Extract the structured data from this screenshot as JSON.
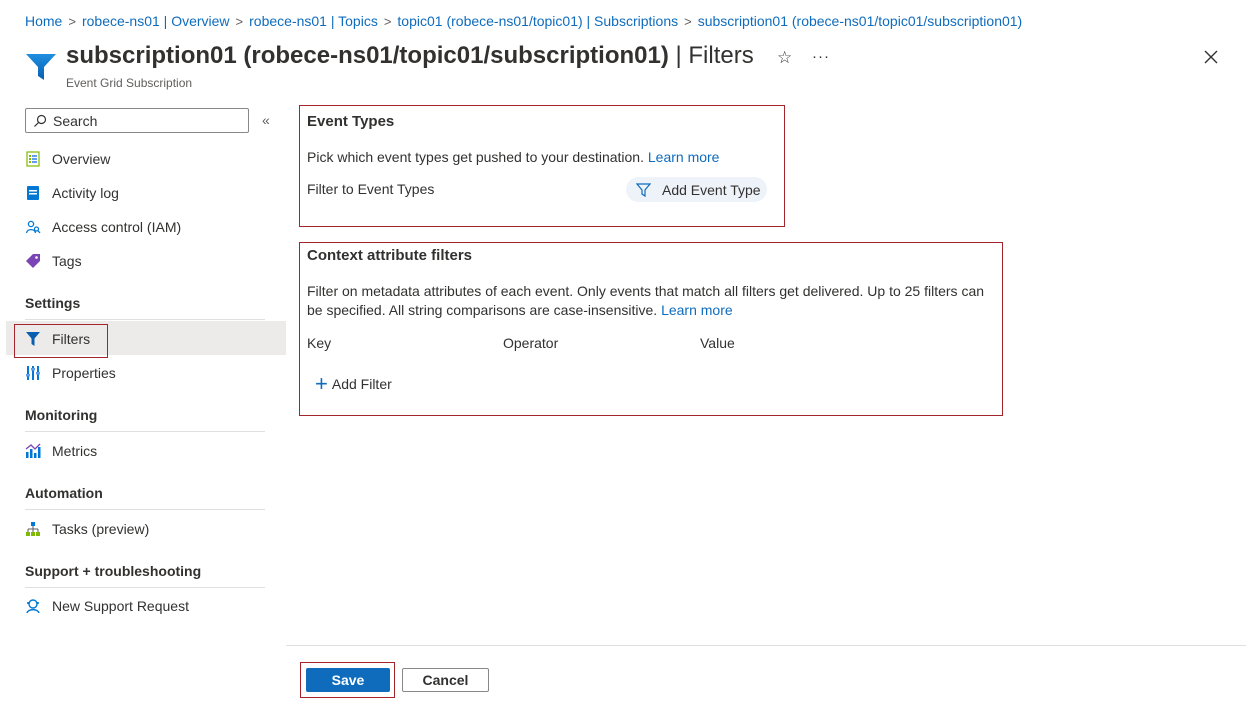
{
  "breadcrumb": {
    "items": [
      "Home",
      "robece-ns01 | Overview",
      "robece-ns01 | Topics",
      "topic01 (robece-ns01/topic01) | Subscriptions",
      "subscription01 (robece-ns01/topic01/subscription01)"
    ],
    "separator": ">"
  },
  "header": {
    "title": "subscription01 (robece-ns01/topic01/subscription01)",
    "title_suffix": " | Filters",
    "subtitle": "Event Grid Subscription",
    "favorite_icon": "star-icon",
    "more_glyph": "···",
    "close_icon": "close-icon"
  },
  "sidebar": {
    "search_placeholder": "Search",
    "collapse_glyph": "«",
    "items": [
      {
        "label": "Overview",
        "icon": "overview-icon"
      },
      {
        "label": "Activity log",
        "icon": "activity-log-icon"
      },
      {
        "label": "Access control (IAM)",
        "icon": "iam-icon"
      },
      {
        "label": "Tags",
        "icon": "tag-icon"
      }
    ],
    "sections": [
      {
        "title": "Settings",
        "items": [
          {
            "label": "Filters",
            "icon": "filter-icon",
            "selected": true
          },
          {
            "label": "Properties",
            "icon": "properties-icon"
          }
        ]
      },
      {
        "title": "Monitoring",
        "items": [
          {
            "label": "Metrics",
            "icon": "metrics-icon"
          }
        ]
      },
      {
        "title": "Automation",
        "items": [
          {
            "label": "Tasks (preview)",
            "icon": "tasks-icon"
          }
        ]
      },
      {
        "title": "Support + troubleshooting",
        "items": [
          {
            "label": "New Support Request",
            "icon": "support-icon"
          }
        ]
      }
    ]
  },
  "event_types": {
    "title": "Event Types",
    "description": "Pick which event types get pushed to your destination.",
    "learn_more": "Learn more",
    "filter_label": "Filter to Event Types",
    "add_button": "Add Event Type"
  },
  "context_filters": {
    "title": "Context attribute filters",
    "description": "Filter on metadata attributes of each event. Only events that match all filters get delivered. Up to 25 filters can be specified. All string comparisons are case-insensitive.",
    "learn_more": "Learn more",
    "columns": [
      "Key",
      "Operator",
      "Value"
    ],
    "add_button": "Add Filter"
  },
  "footer": {
    "save_label": "Save",
    "cancel_label": "Cancel"
  },
  "colors": {
    "link": "#0f6cbd",
    "primary_button": "#0f6cbd",
    "highlight_border": "#a4262c",
    "selected_nav_bg": "#edebe9"
  }
}
